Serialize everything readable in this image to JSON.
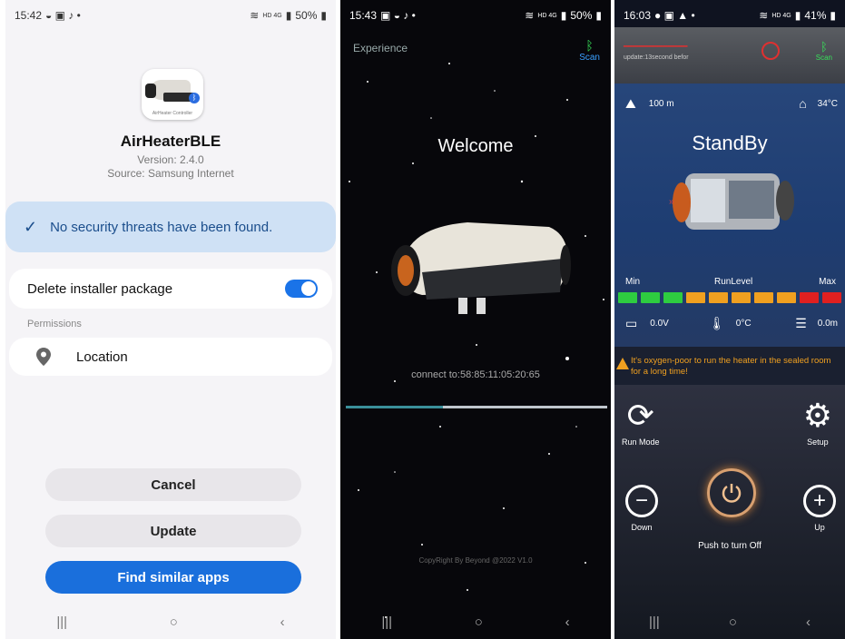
{
  "panel1": {
    "status": {
      "time": "15:42",
      "battery": "50%",
      "net": "HD 4G"
    },
    "app_icon_caption": "AirHeater Controller",
    "app_name": "AirHeaterBLE",
    "version": "Version: 2.4.0",
    "source": "Source: Samsung Internet",
    "security_message": "No security threats have been found.",
    "delete_installer_label": "Delete installer package",
    "delete_installer_on": true,
    "permissions_header": "Permissions",
    "permission_location": "Location",
    "cancel_label": "Cancel",
    "update_label": "Update",
    "find_similar_label": "Find similar apps"
  },
  "panel2": {
    "status": {
      "time": "15:43",
      "battery": "50%",
      "net": "HD 4G"
    },
    "experience_label": "Experience",
    "scan_label": "Scan",
    "welcome_text": "Welcome",
    "connect_text": "connect to:58:85:11:05:20:65",
    "progress_fraction": 0.37,
    "copyright": "CopyRight By Beyond @2022 V1.0"
  },
  "panel3": {
    "status": {
      "time": "16:03",
      "battery": "41%",
      "net": "HD 4G"
    },
    "update_text": "update:13second befor",
    "scan_label": "Scan",
    "altitude": "100 m",
    "ambient_temp": "34°C",
    "state": "StandBy",
    "level_min": "Min",
    "level_label": "RunLevel",
    "level_max": "Max",
    "level_colors": [
      "#2ecc40",
      "#2ecc40",
      "#2ecc40",
      "#f0a020",
      "#f0a020",
      "#f0a020",
      "#f0a020",
      "#f0a020",
      "#e02020",
      "#e02020"
    ],
    "voltage": "0.0V",
    "heater_temp": "0°C",
    "altitude2": "0.0m",
    "alert": "It's oxygen-poor to run the heater in the sealed room for a long time!",
    "run_mode_label": "Run Mode",
    "setup_label": "Setup",
    "down_label": "Down",
    "up_label": "Up",
    "power_label": "Push to turn Off"
  },
  "colors": {
    "blue_button": "#1a6fdc",
    "banner": "#cfe1f5",
    "scan_blue": "#3aa0ff",
    "scan_green": "#38e05a",
    "warning": "#f0a020"
  }
}
